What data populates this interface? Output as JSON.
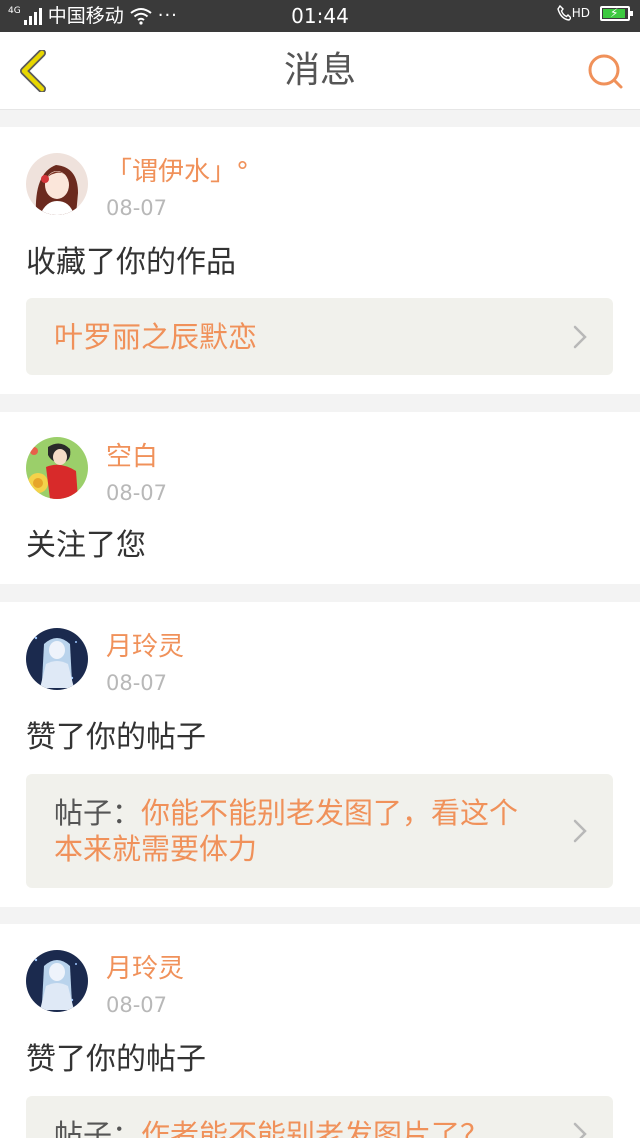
{
  "status_bar": {
    "network_tag": "4G",
    "carrier": "中国移动",
    "more": "···",
    "time": "01:44",
    "hd": "HD",
    "battery_level": 0.85,
    "battery_color": "#3cc93f"
  },
  "header": {
    "title": "消息",
    "back_icon": "chevron-left-icon",
    "search_icon": "search-icon"
  },
  "colors": {
    "accent": "#f0915a",
    "back_icon": "#e8d700",
    "background": "#f3f3f3"
  },
  "messages": [
    {
      "user": "「谓伊水」°",
      "date": "08-07",
      "action": "收藏了你的作品",
      "ref": {
        "prefix": "",
        "text": "叶罗丽之辰默恋"
      }
    },
    {
      "user": "空白",
      "date": "08-07",
      "action": "关注了您"
    },
    {
      "user": "月玲灵",
      "date": "08-07",
      "action": "赞了你的帖子",
      "ref": {
        "prefix": "帖子：",
        "text": "你能不能别老发图了，看这个本来就需要体力"
      }
    },
    {
      "user": "月玲灵",
      "date": "08-07",
      "action": "赞了你的帖子",
      "ref": {
        "prefix": "帖子：",
        "text": "作者能不能别老发图片了？"
      }
    }
  ]
}
